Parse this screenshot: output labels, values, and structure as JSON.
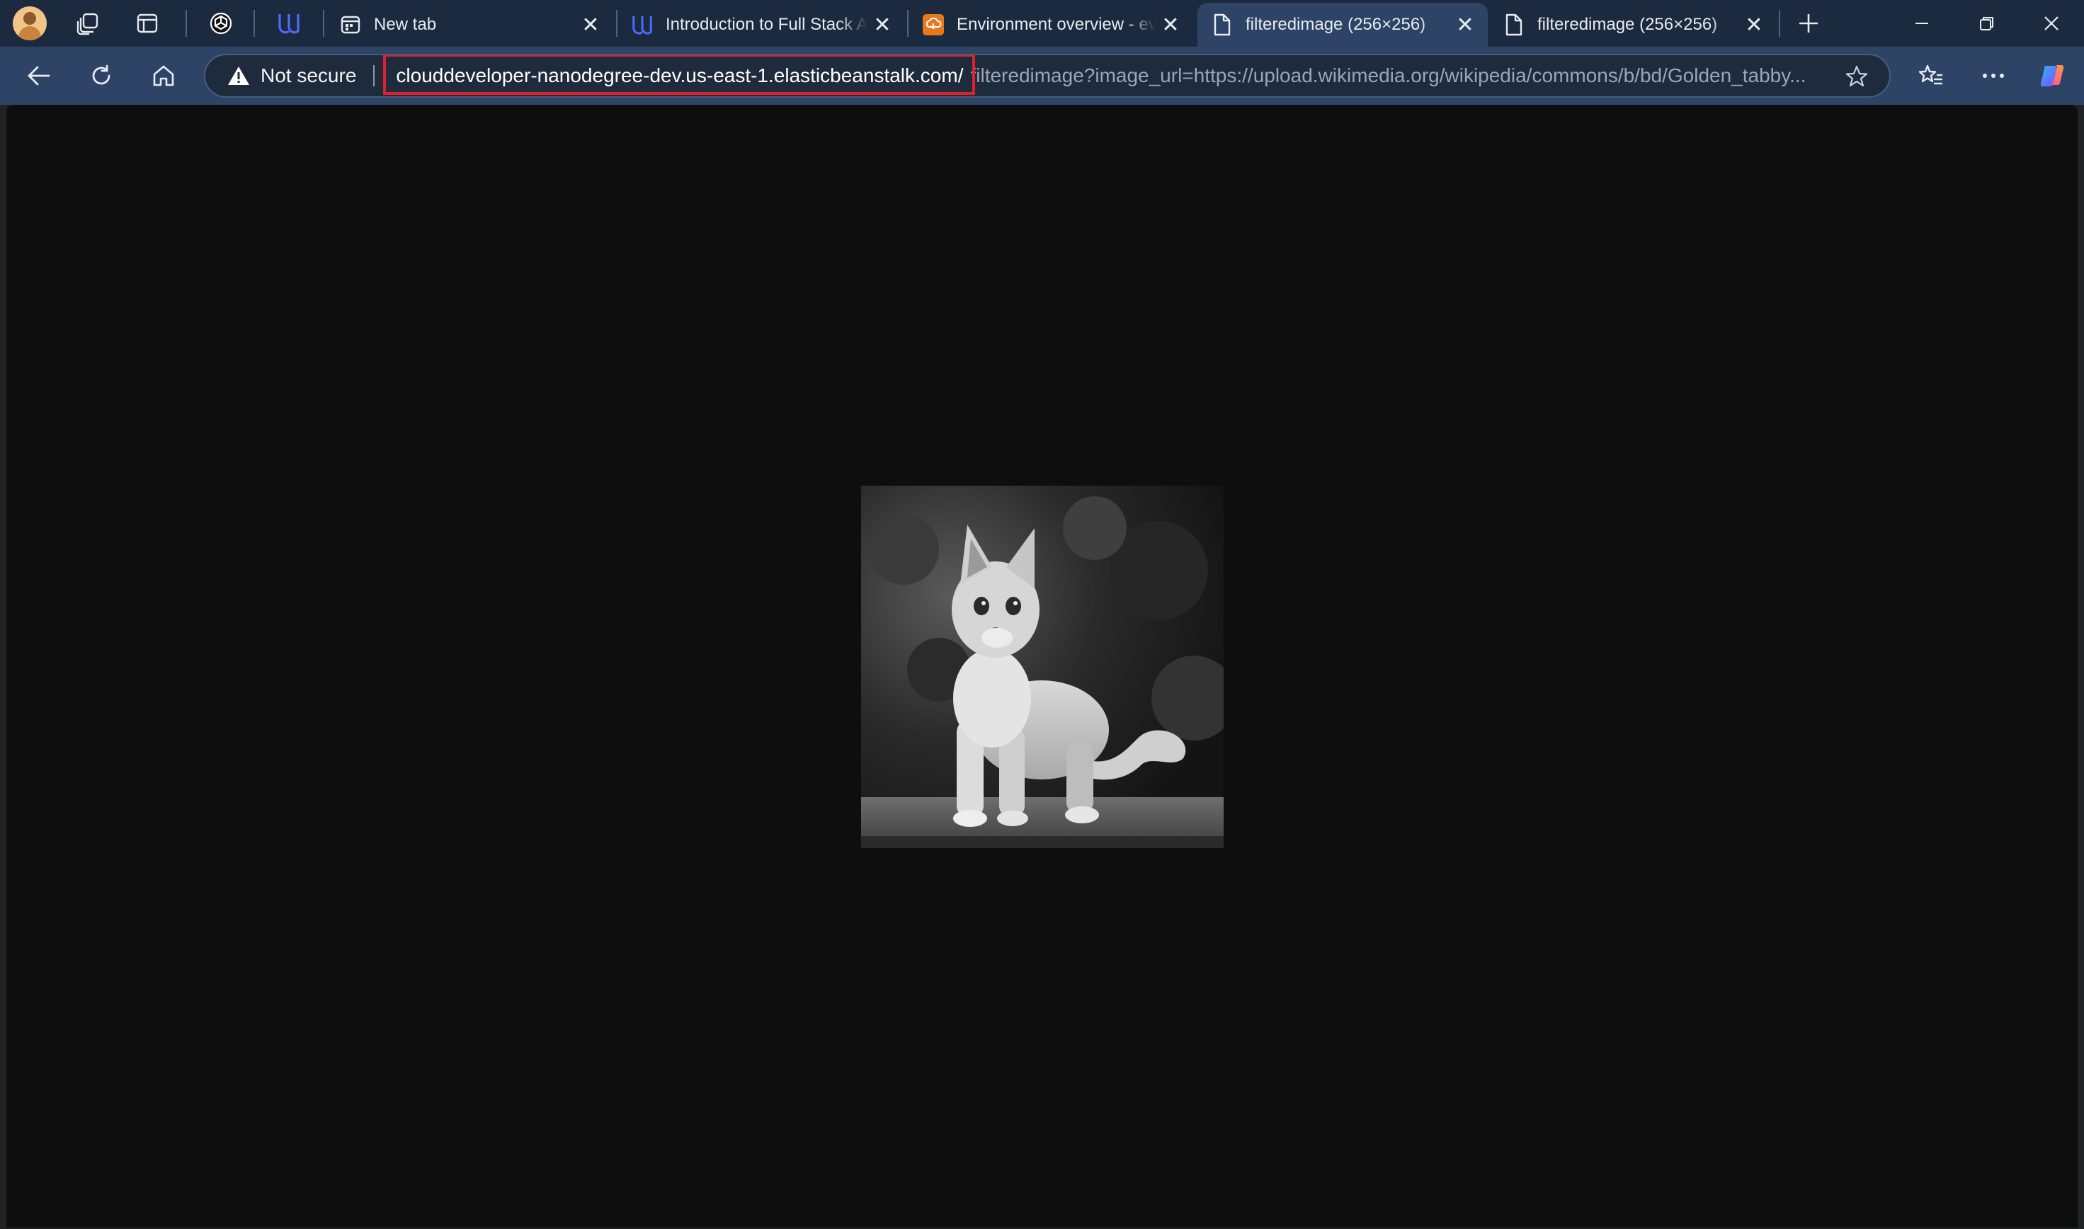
{
  "window": {
    "controls": {
      "minimize_icon": "minimize-icon",
      "restore_icon": "restore-icon",
      "close_icon": "close-icon"
    }
  },
  "tabs": [
    {
      "title": "New tab",
      "favicon": "new-tab-icon",
      "active": false
    },
    {
      "title": "Introduction to Full Stack A",
      "favicon": "udacity-icon",
      "active": false
    },
    {
      "title": "Environment overview - eve",
      "favicon": "aws-icon",
      "active": false
    },
    {
      "title": "filteredimage (256×256)",
      "favicon": "page-icon",
      "active": true
    },
    {
      "title": "filteredimage (256×256)",
      "favicon": "page-icon",
      "active": false
    }
  ],
  "tab_close_glyph": "✕",
  "address_bar": {
    "security_label": "Not secure",
    "url_host": "clouddeveloper-nanodegree-dev.us-east-1.elasticbeanstalk.com/",
    "url_path": "filteredimage?image_url=https://upload.wikimedia.org/wikipedia/commons/b/bd/Golden_tabby..."
  },
  "colors": {
    "tabstrip": "#1b2a3f",
    "toolbar": "#2d4466",
    "highlight_box": "#e0202c",
    "page_background": "#0e0e0e"
  },
  "content": {
    "image_alt_subject": "grayscale kitten",
    "image_size_label": "256×256"
  }
}
